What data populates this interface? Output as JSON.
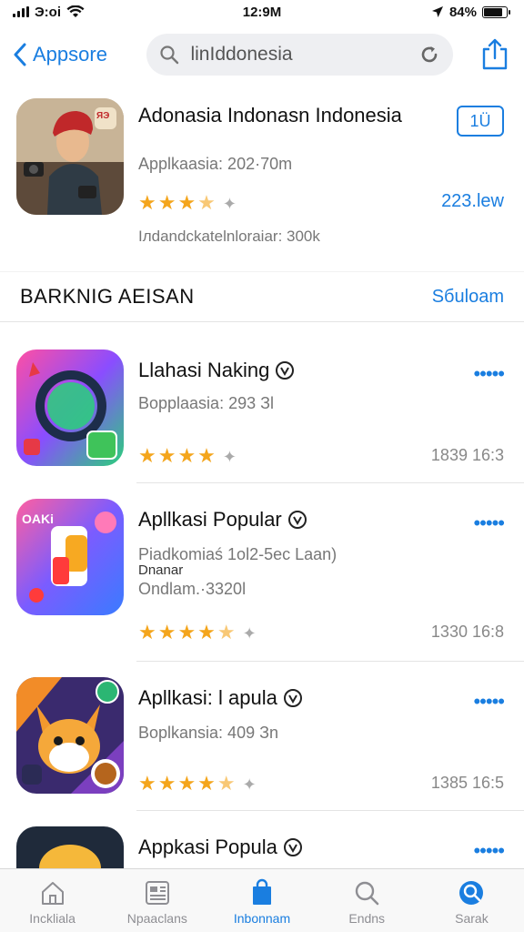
{
  "status_bar": {
    "carrier": "Э:оі",
    "time": "12:9M",
    "battery": "84%",
    "battery_level": 0.84
  },
  "nav": {
    "back_label": "Appsore",
    "search_query": "linIddonesia"
  },
  "featured": {
    "title": "Adonasia Indonasn Indonesia",
    "subtitle": "Applkaasia: 202·70m",
    "rating": 3.5,
    "info": "Ілdandckatelnlorаіаr: 300k",
    "get_label": "1Ü",
    "size": "223.lew",
    "icon_badge": "ЯЭ"
  },
  "section": {
    "title": "BARKNIG AEISAN",
    "link": "Sбulоаm"
  },
  "apps": [
    {
      "title": "Llahasi Naking",
      "lines": [
        "Bopplaasia: 293 Зl"
      ],
      "rating": 4,
      "meta": "1839 16:3",
      "more": "•••••"
    },
    {
      "title": "Apllkasi Popular",
      "lines": [
        "Piadkomiaś 1ol2-5ec Laan)",
        "Dnanar",
        "Ondlam.·3320l"
      ],
      "rating": 4.5,
      "meta": "1330 16:8",
      "more": "•••••",
      "icon_badge": "OAKi"
    },
    {
      "title": "Apllkasi: l apula",
      "lines": [
        "Boplkansia: 409 Зn"
      ],
      "rating": 4.5,
      "meta": "1385 16:5",
      "more": "•••••"
    },
    {
      "title": "Appkasi Populа",
      "lines": [],
      "rating": 0,
      "meta": "",
      "more": "•••••"
    }
  ],
  "tabs": [
    {
      "label": "Inckliala",
      "icon": "today-icon"
    },
    {
      "label": "Npaaclans",
      "icon": "games-icon"
    },
    {
      "label": "Inbonnam",
      "icon": "apps-icon",
      "active": true
    },
    {
      "label": "Endns",
      "icon": "search-icon"
    },
    {
      "label": "Sarak",
      "icon": "arcade-icon"
    }
  ]
}
